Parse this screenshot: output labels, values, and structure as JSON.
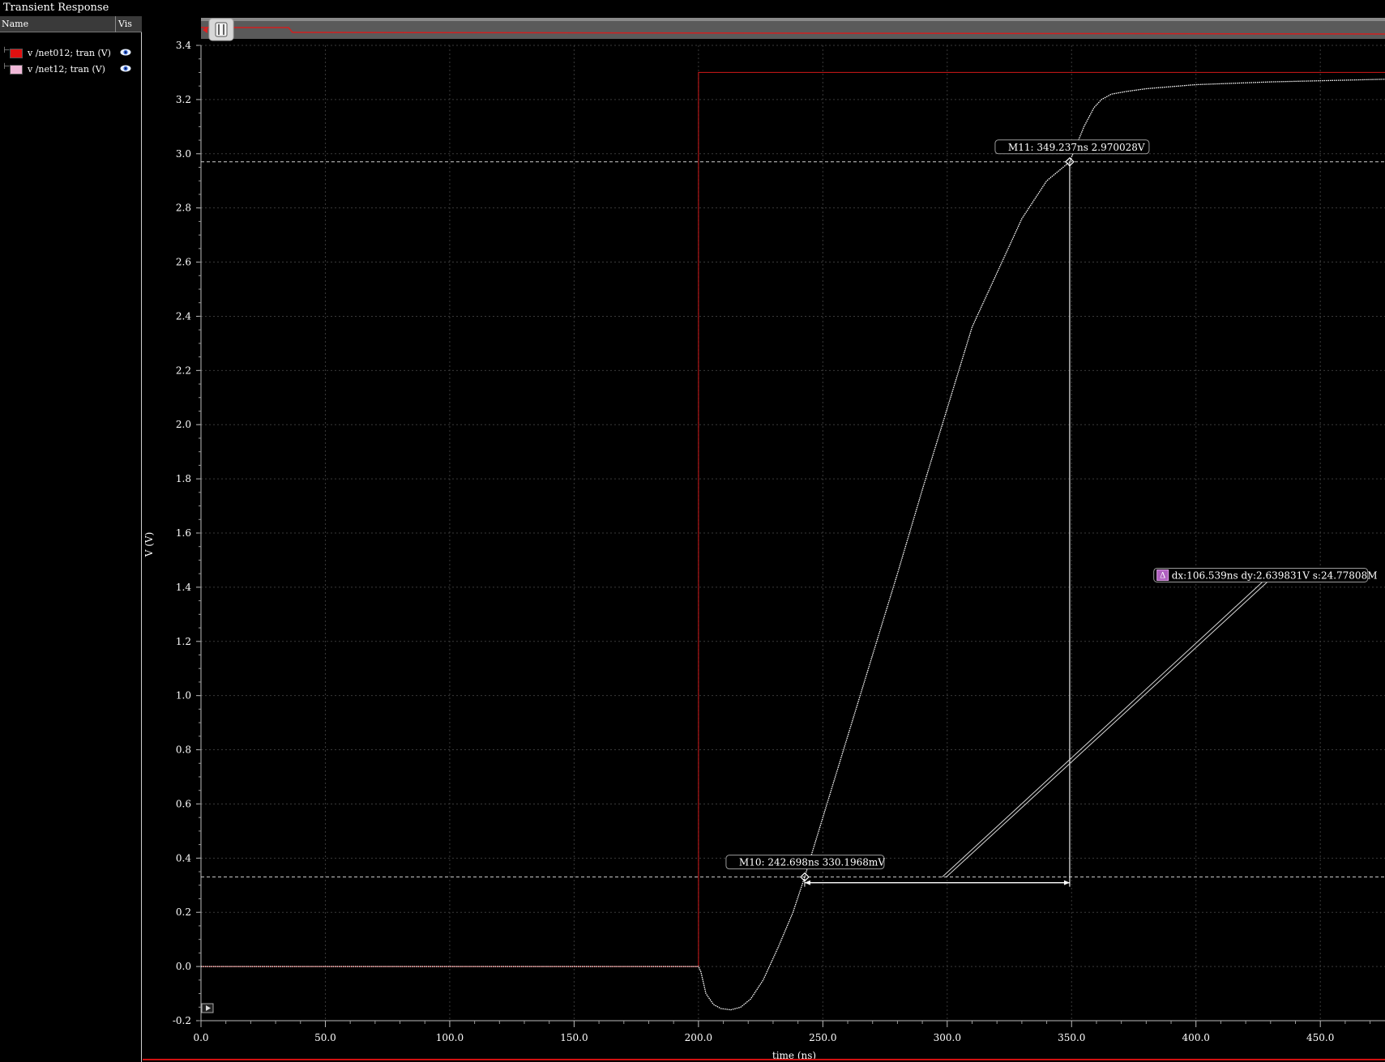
{
  "window": {
    "title": "Transient Response"
  },
  "legend": {
    "col_name": "Name",
    "col_vis": "Vis",
    "traces": [
      {
        "label": "v /net012; tran (V)",
        "color": "#e01010",
        "visible": true
      },
      {
        "label": "v /net12; tran (V)",
        "color": "#f0b8d8",
        "visible": true
      }
    ]
  },
  "chart_data": {
    "type": "line",
    "xlabel": "time (ns)",
    "ylabel": "V (V)",
    "xlim": [
      0,
      476
    ],
    "ylim": [
      -0.2,
      3.4
    ],
    "x_ticks": [
      0.0,
      50.0,
      100.0,
      150.0,
      200.0,
      250.0,
      300.0,
      350.0,
      400.0,
      450.0
    ],
    "y_ticks": [
      -0.2,
      0.0,
      0.2,
      0.4,
      0.6,
      0.8,
      1.0,
      1.2,
      1.4,
      1.6,
      1.8,
      2.0,
      2.2,
      2.4,
      2.6,
      2.8,
      3.0,
      3.2,
      3.4
    ],
    "grid": true,
    "series": [
      {
        "name": "v /net012; tran (V)",
        "color": "#d21a1a",
        "x": [
          0,
          200,
          200,
          476
        ],
        "y": [
          0,
          0,
          3.3,
          3.3
        ]
      },
      {
        "name": "v /net12; tran (V)",
        "color": "#ffffff",
        "x": [
          0,
          200,
          201,
          203,
          206,
          209,
          213,
          217,
          221,
          226,
          232,
          238,
          242.698,
          250,
          260,
          270,
          280,
          290,
          300,
          310,
          320,
          330,
          340,
          349.237,
          355,
          359,
          362,
          366,
          372,
          380,
          400,
          430,
          476
        ],
        "y": [
          0,
          0,
          -0.02,
          -0.1,
          -0.14,
          -0.155,
          -0.16,
          -0.15,
          -0.12,
          -0.05,
          0.07,
          0.2,
          0.33,
          0.55,
          0.85,
          1.15,
          1.45,
          1.76,
          2.06,
          2.36,
          2.56,
          2.76,
          2.9,
          2.97,
          3.1,
          3.17,
          3.2,
          3.22,
          3.23,
          3.24,
          3.255,
          3.265,
          3.275
        ]
      }
    ],
    "markers": [
      {
        "id": "M10",
        "label": "M10: 242.698ns 330.1968mV",
        "x": 242.698,
        "y": 0.3302
      },
      {
        "id": "M11",
        "label": "M11: 349.237ns 2.970028V",
        "x": 349.237,
        "y": 2.970028
      }
    ],
    "delta": {
      "label": "dx:106.539ns dy:2.639831V s:24.77808M",
      "badge": "Δ",
      "dx": 106.539,
      "dy": 2.639831
    }
  }
}
